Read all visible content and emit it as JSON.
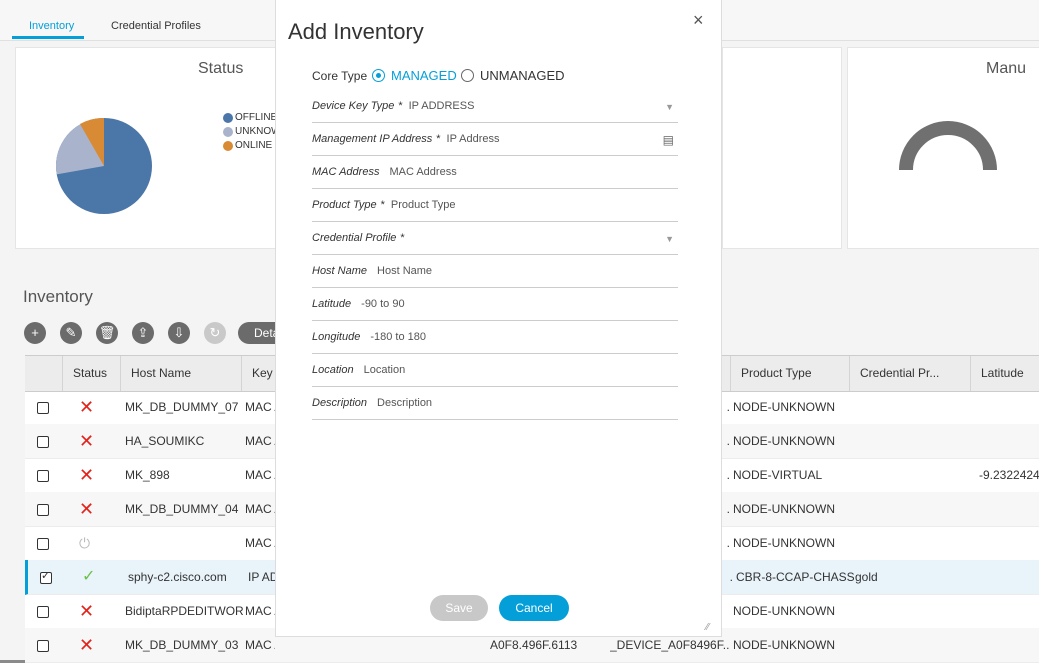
{
  "tabs": [
    {
      "label": "Inventory"
    },
    {
      "label": "Credential Profiles"
    }
  ],
  "status_card": {
    "title": "Status",
    "legend": [
      {
        "label": "OFFLINE",
        "color": "#4a76a8"
      },
      {
        "label": "UNKNOW",
        "color": "#a9b4cc"
      },
      {
        "label": "ONLINE",
        "color": "#d88a34"
      }
    ]
  },
  "manu_card": {
    "title": "Manu"
  },
  "inventory": {
    "title": "Inventory",
    "details_label": "Deta",
    "columns": [
      "Status",
      "Host Name",
      "Key",
      "Product Type",
      "Credential Pr...",
      "Latitude"
    ],
    "rows": [
      {
        "status": "x",
        "host": "MK_DB_DUMMY_07",
        "key": "MAC A",
        "extra": ".",
        "product": "NODE-UNKNOWN",
        "cred": "",
        "lat": ""
      },
      {
        "status": "x",
        "host": "HA_SOUMIKC",
        "key": "MAC A",
        "extra": ".",
        "product": "NODE-UNKNOWN",
        "cred": "",
        "lat": ""
      },
      {
        "status": "x",
        "host": "MK_898",
        "key": "MAC A",
        "extra": ".",
        "product": "NODE-VIRTUAL",
        "cred": "",
        "lat": "-9.2322424"
      },
      {
        "status": "x",
        "host": "MK_DB_DUMMY_04",
        "key": "MAC A",
        "extra": ".",
        "product": "NODE-UNKNOWN",
        "cred": "",
        "lat": ""
      },
      {
        "status": "power",
        "host": "",
        "key": "MAC A",
        "extra": ".",
        "product": "NODE-UNKNOWN",
        "cred": "",
        "lat": ""
      },
      {
        "status": "check",
        "host": "sphy-c2.cisco.com",
        "key": "IP AD",
        "extra": ".",
        "product": "CBR-8-CCAP-CHASS",
        "cred": "gold",
        "lat": ""
      },
      {
        "status": "x",
        "host": "BidiptaRPDEDITWOR...",
        "key": "MAC A",
        "extra": "",
        "product": "NODE-UNKNOWN",
        "cred": "",
        "lat": ""
      },
      {
        "status": "x",
        "host": "MK_DB_DUMMY_03",
        "key": "MAC ADDRESS",
        "extra": "_DEVICE_A0F8496F...",
        "mac": "A0F8.496F.6113",
        "product": "NODE-UNKNOWN",
        "cred": "",
        "lat": ""
      }
    ]
  },
  "modal": {
    "title": "Add Inventory",
    "close_glyph": "×",
    "core_type_label": "Core Type",
    "core_options": [
      "MANAGED",
      "UNMANAGED"
    ],
    "fields": [
      {
        "label": "Device Key Type",
        "required": "*",
        "value": "IP ADDRESS",
        "kind": "select"
      },
      {
        "label": "Management IP Address",
        "required": "*",
        "value": "IP Address",
        "kind": "icon"
      },
      {
        "label": "MAC Address",
        "required": "",
        "value": "MAC Address",
        "kind": "text"
      },
      {
        "label": "Product Type",
        "required": "*",
        "value": "Product Type",
        "kind": "text"
      },
      {
        "label": "Credential Profile",
        "required": "*",
        "value": "",
        "kind": "select"
      },
      {
        "label": "Host Name",
        "required": "",
        "value": "Host Name",
        "kind": "text"
      },
      {
        "label": "Latitude",
        "required": "",
        "value": "-90 to 90",
        "kind": "text"
      },
      {
        "label": "Longitude",
        "required": "",
        "value": "-180 to 180",
        "kind": "text"
      },
      {
        "label": "Location",
        "required": "",
        "value": "Location",
        "kind": "text"
      },
      {
        "label": "Description",
        "required": "",
        "value": "Description",
        "kind": "text"
      }
    ],
    "save_label": "Save",
    "cancel_label": "Cancel"
  }
}
